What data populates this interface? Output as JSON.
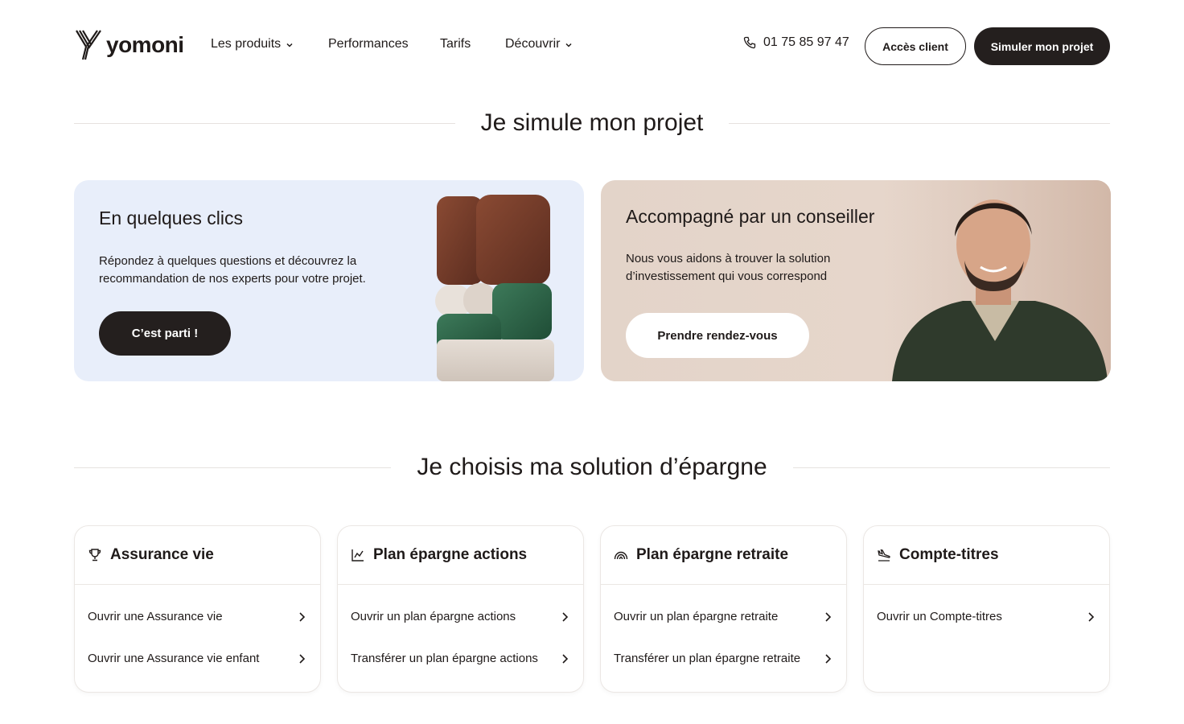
{
  "header": {
    "brand": "yomoni",
    "nav": [
      {
        "label": "Les produits",
        "has_dropdown": true
      },
      {
        "label": "Performances",
        "has_dropdown": false
      },
      {
        "label": "Tarifs",
        "has_dropdown": false
      },
      {
        "label": "Découvrir",
        "has_dropdown": true
      }
    ],
    "phone": "01 75 85 97 47",
    "client_button": "Accès client",
    "simulate_button": "Simuler mon projet"
  },
  "simulate_section": {
    "title": "Je simule mon projet",
    "left_card": {
      "title": "En quelques clics",
      "text": "Répondez à quelques questions et découvrez la recommandation de nos experts pour votre projet.",
      "button": "C’est parti !"
    },
    "right_card": {
      "title": "Accompagné par un conseiller",
      "text": "Nous vous aidons à trouver la solution d’investissement qui vous correspond",
      "button": "Prendre rendez-vous"
    }
  },
  "savings_section": {
    "title": "Je choisis ma solution d’épargne",
    "cards": [
      {
        "icon": "trophy-icon",
        "title": "Assurance vie",
        "links": [
          "Ouvrir une Assurance vie",
          "Ouvrir une Assurance vie enfant"
        ]
      },
      {
        "icon": "chart-line-icon",
        "title": "Plan épargne actions",
        "links": [
          "Ouvrir un plan épargne actions",
          "Transférer un plan épargne actions"
        ]
      },
      {
        "icon": "rainbow-icon",
        "title": "Plan épargne retraite",
        "links": [
          "Ouvrir un plan épargne retraite",
          "Transférer un plan épargne retraite"
        ]
      },
      {
        "icon": "plane-landing-icon",
        "title": "Compte-titres",
        "links": [
          "Ouvrir un Compte-titres"
        ]
      }
    ]
  },
  "colors": {
    "dark": "#241f1e",
    "left_card_bg": "#e8eefa",
    "right_card_bg": "#e3d4c9"
  }
}
